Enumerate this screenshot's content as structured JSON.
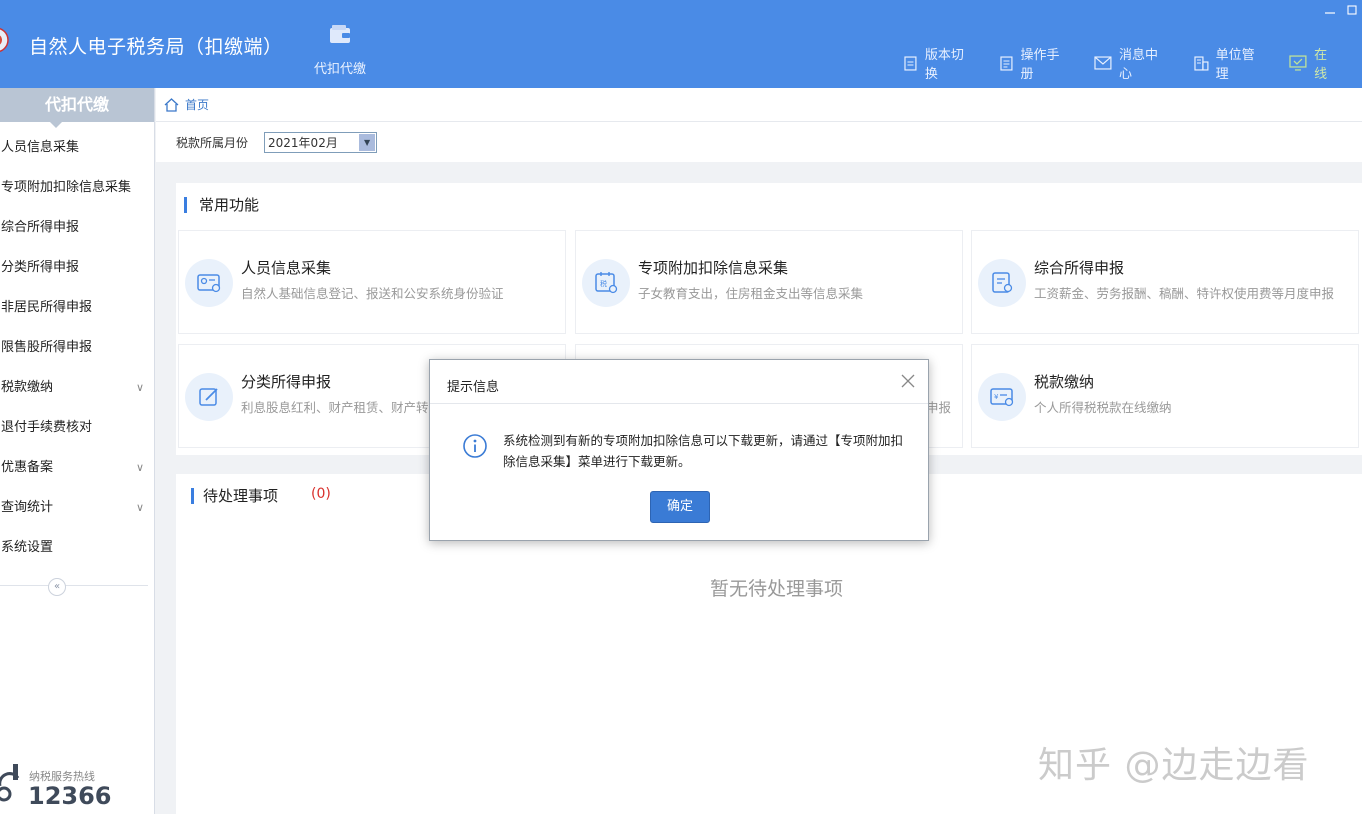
{
  "header": {
    "app_title": "自然人电子税务局（扣缴端）",
    "module": {
      "label": "代扣代缴",
      "icon": "wallet-icon"
    },
    "links": [
      {
        "label": "版本切换",
        "icon": "document-icon"
      },
      {
        "label": "操作手册",
        "icon": "manual-icon"
      },
      {
        "label": "消息中心",
        "icon": "mail-icon"
      },
      {
        "label": "单位管理",
        "icon": "building-icon"
      },
      {
        "label": "在线",
        "icon": "monitor-icon"
      }
    ]
  },
  "sidebar": {
    "title": "代扣代缴",
    "items": [
      {
        "label": "人员信息采集",
        "chevron": ""
      },
      {
        "label": "专项附加扣除信息采集",
        "chevron": ""
      },
      {
        "label": "综合所得申报",
        "chevron": ""
      },
      {
        "label": "分类所得申报",
        "chevron": ""
      },
      {
        "label": "非居民所得申报",
        "chevron": ""
      },
      {
        "label": "限售股所得申报",
        "chevron": ""
      },
      {
        "label": "税款缴纳",
        "chevron": "∨"
      },
      {
        "label": "退付手续费核对",
        "chevron": ""
      },
      {
        "label": "优惠备案",
        "chevron": "∨"
      },
      {
        "label": "查询统计",
        "chevron": "∨"
      },
      {
        "label": "系统设置",
        "chevron": ""
      }
    ],
    "collapse_symbol": "«",
    "hotline_label": "纳税服务热线",
    "hotline_number": "12366"
  },
  "breadcrumb": {
    "home": "首页"
  },
  "period": {
    "label": "税款所属月份",
    "value": "2021年02月"
  },
  "common": {
    "title": "常用功能",
    "cards": [
      {
        "title": "人员信息采集",
        "desc": "自然人基础信息登记、报送和公安系统身份验证",
        "icon": "id-card-icon"
      },
      {
        "title": "专项附加扣除信息采集",
        "desc": "子女教育支出，住房租金支出等信息采集",
        "icon": "tax-calendar-icon"
      },
      {
        "title": "综合所得申报",
        "desc": "工资薪金、劳务报酬、稿酬、特许权使用费等月度申报",
        "icon": "report-icon"
      },
      {
        "title": "分类所得申报",
        "desc": "利息股息红利、财产租赁、财产转让等申报",
        "icon": "edit-icon"
      },
      {
        "title": "",
        "desc": "申报",
        "icon": ""
      },
      {
        "title": "税款缴纳",
        "desc": "个人所得税税款在线缴纳",
        "icon": "payment-icon"
      }
    ]
  },
  "pending": {
    "title": "待处理事项",
    "count": "(0)",
    "empty": "暂无待处理事项"
  },
  "dialog": {
    "title": "提示信息",
    "message": "系统检测到有新的专项附加扣除信息可以下载更新，请通过【专项附加扣除信息采集】菜单进行下载更新。",
    "ok_label": "确定"
  },
  "watermark": "知乎 @边走边看",
  "colors": {
    "header": "#4a8be6",
    "accent": "#3a7bd5",
    "danger": "#d9302c"
  }
}
